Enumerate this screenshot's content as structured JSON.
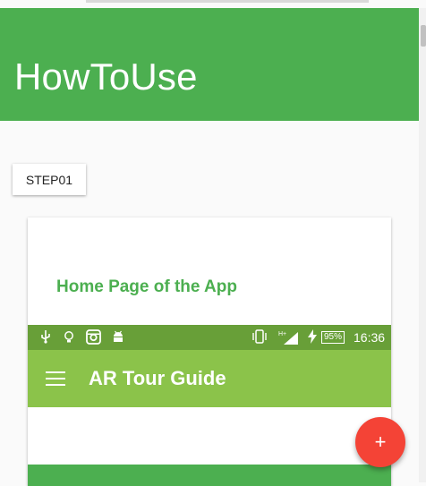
{
  "header": {
    "title": "HowToUse",
    "color": "#4caf50"
  },
  "step_button": {
    "label": "STEP01"
  },
  "card": {
    "heading": "Home Page of the App",
    "screenshot": {
      "statusbar": {
        "icons": [
          "usb-icon",
          "lightbulb-icon",
          "instagram-icon",
          "android-icon",
          "vibrate-icon",
          "signal-icon",
          "charging-icon"
        ],
        "network": "H+",
        "battery": "95%",
        "time": "16:36",
        "color": "#689f38"
      },
      "appbar": {
        "title": "AR Tour Guide",
        "color": "#8bc34a"
      }
    }
  },
  "fab": {
    "label": "+",
    "color": "#f44336"
  }
}
